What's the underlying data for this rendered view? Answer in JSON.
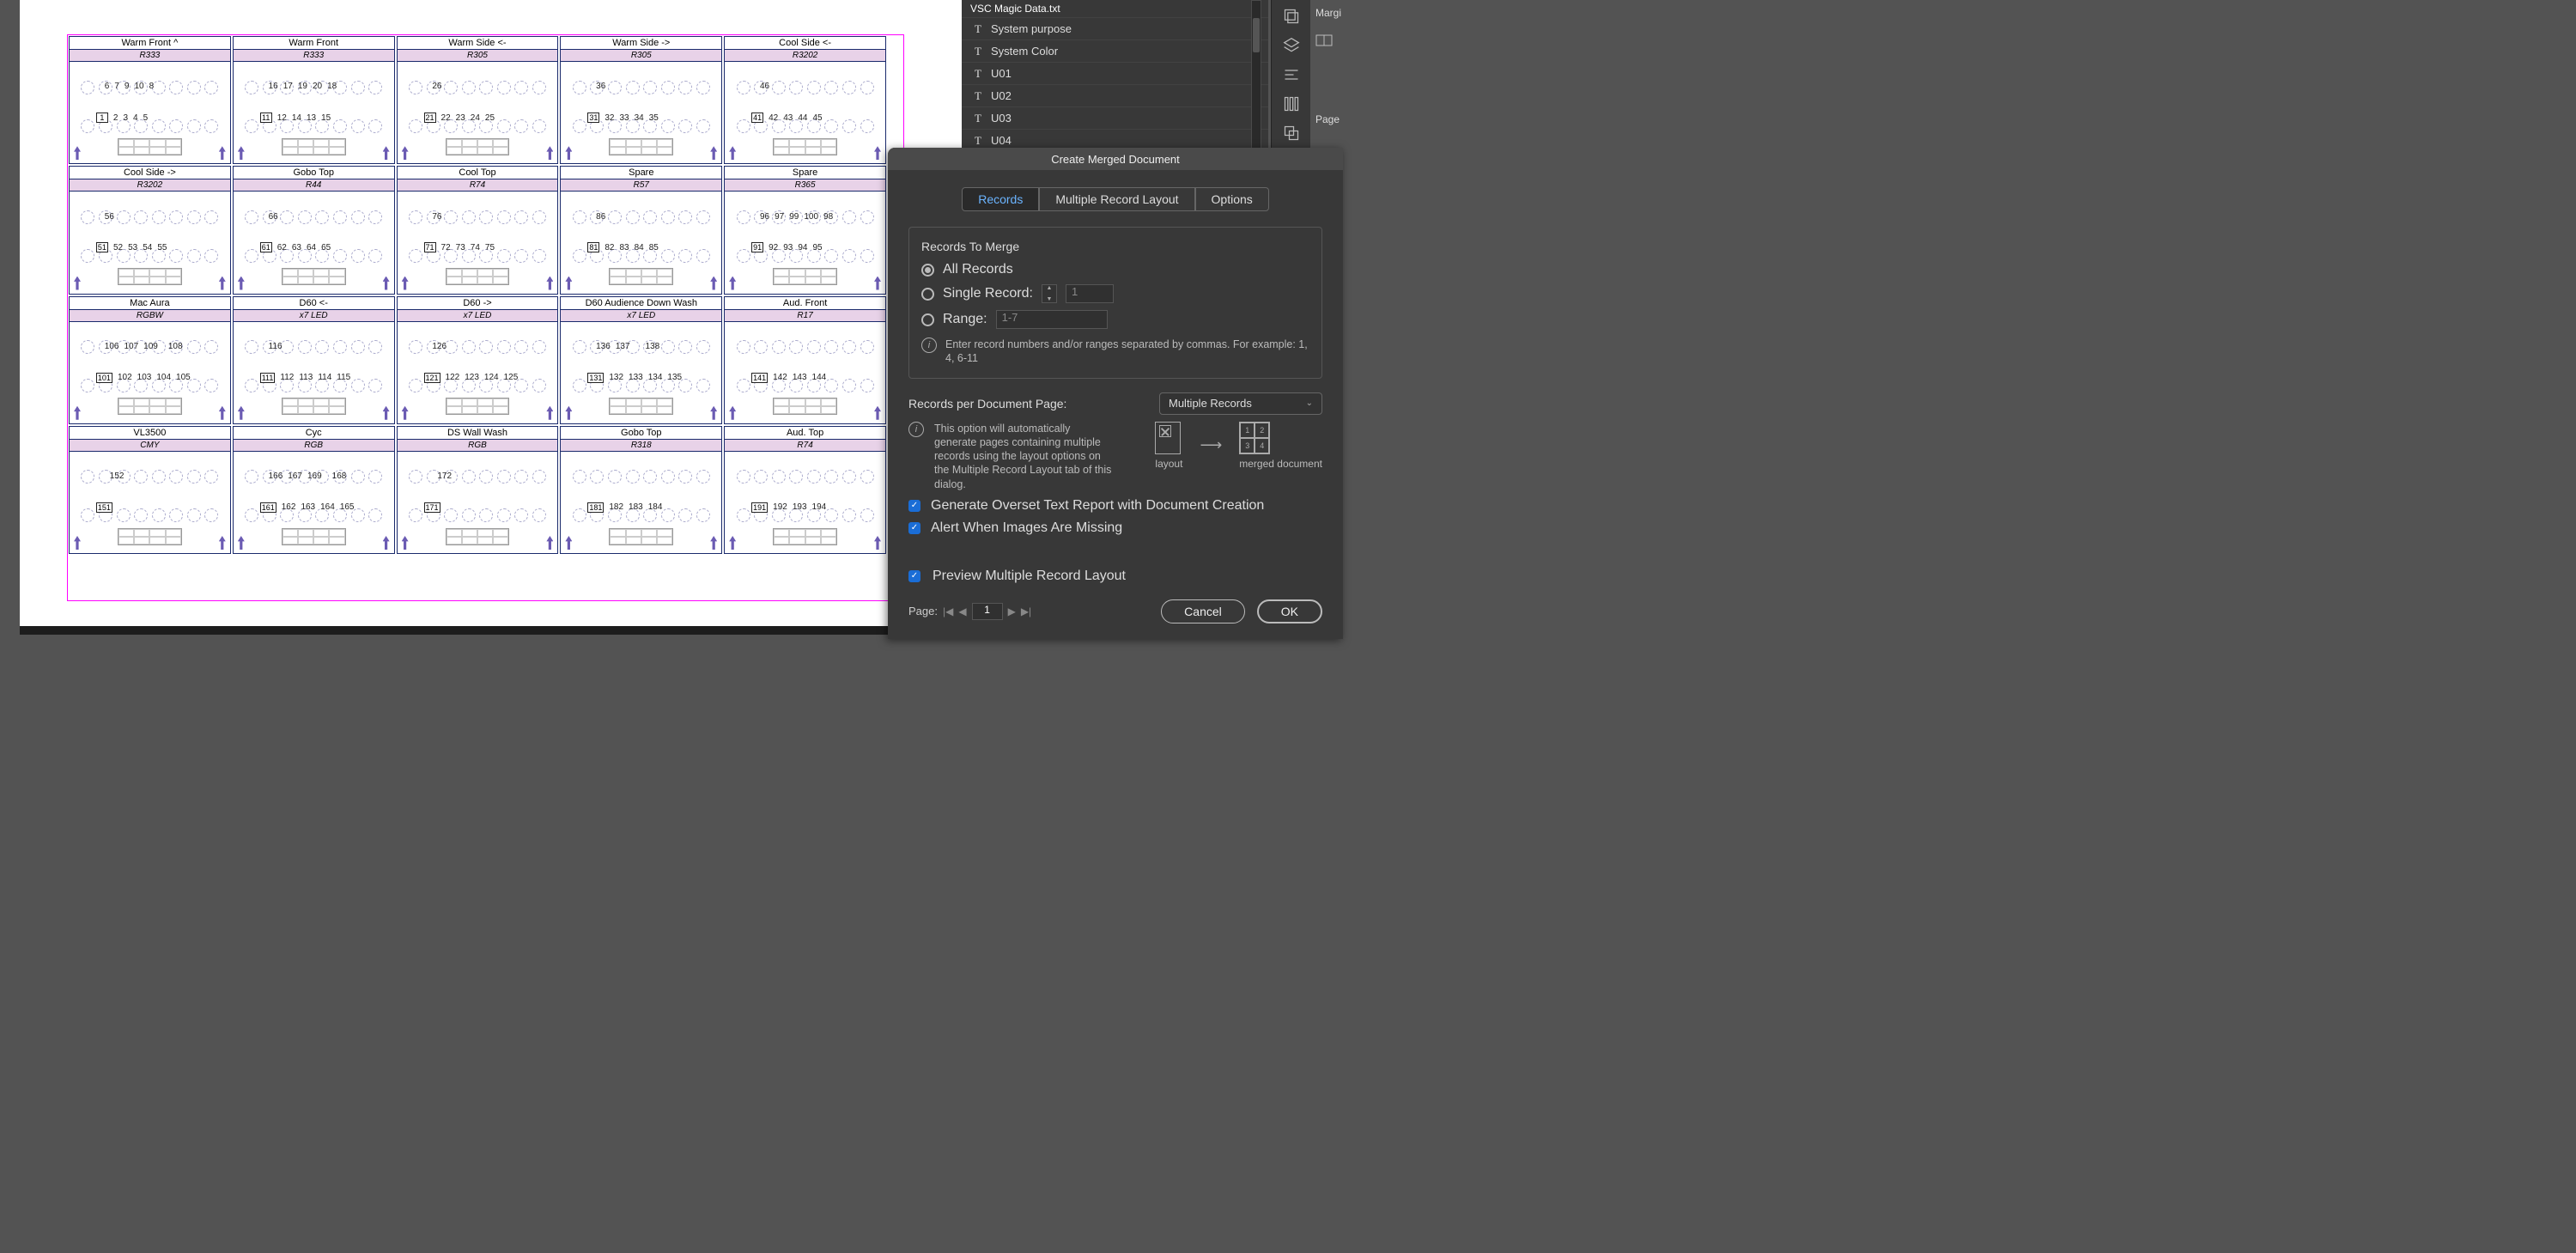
{
  "canvas": {
    "cards": [
      [
        {
          "title": "Warm Front ^",
          "sub": "R333",
          "box": "1",
          "nums": [
            "6",
            "7",
            "9",
            "10",
            "8",
            "2",
            "3",
            "4",
            "5"
          ]
        },
        {
          "title": "Warm Front",
          "sub": "R333",
          "box": "11",
          "nums": [
            "16",
            "17",
            "19",
            "20",
            "18",
            "12",
            "14",
            "13",
            "15"
          ]
        },
        {
          "title": "Warm Side <-",
          "sub": "R305",
          "box": "21",
          "nums": [
            "26",
            "",
            "",
            "",
            "",
            "22",
            "23",
            "24",
            "25"
          ]
        },
        {
          "title": "Warm Side ->",
          "sub": "R305",
          "box": "31",
          "nums": [
            "36",
            "",
            "",
            "",
            "",
            "32",
            "33",
            "34",
            "35"
          ]
        },
        {
          "title": "Cool Side <-",
          "sub": "R3202",
          "box": "41",
          "nums": [
            "46",
            "",
            "",
            "",
            "",
            "42",
            "43",
            "44",
            "45"
          ]
        }
      ],
      [
        {
          "title": "Cool Side ->",
          "sub": "R3202",
          "box": "51",
          "nums": [
            "56",
            "",
            "",
            "",
            "",
            "52",
            "53",
            "54",
            "55"
          ]
        },
        {
          "title": "Gobo Top",
          "sub": "R44",
          "box": "61",
          "nums": [
            "66",
            "",
            "",
            "",
            "",
            "62",
            "63",
            "64",
            "65"
          ]
        },
        {
          "title": "Cool Top",
          "sub": "R74",
          "box": "71",
          "nums": [
            "76",
            "",
            "",
            "",
            "",
            "72",
            "73",
            "74",
            "75"
          ]
        },
        {
          "title": "Spare",
          "sub": "R57",
          "box": "81",
          "nums": [
            "86",
            "",
            "",
            "",
            "",
            "82",
            "83",
            "84",
            "85"
          ]
        },
        {
          "title": "Spare",
          "sub": "R365",
          "box": "91",
          "nums": [
            "96",
            "97",
            "99",
            "100",
            "98",
            "92",
            "93",
            "94",
            "95"
          ]
        }
      ],
      [
        {
          "title": "Mac Aura",
          "sub": "RGBW",
          "box": "101",
          "nums": [
            "106",
            "107",
            "109",
            "",
            "108",
            "102",
            "103",
            "104",
            "105"
          ]
        },
        {
          "title": "D60 <-",
          "sub": "x7 LED",
          "box": "111",
          "nums": [
            "116",
            "",
            "",
            "",
            "",
            "112",
            "113",
            "114",
            "115"
          ]
        },
        {
          "title": "D60 ->",
          "sub": "x7 LED",
          "box": "121",
          "nums": [
            "126",
            "",
            "",
            "",
            "",
            "122",
            "123",
            "124",
            "125"
          ]
        },
        {
          "title": "D60 Audience Down Wash",
          "sub": "x7 LED",
          "box": "131",
          "nums": [
            "136",
            "137",
            "",
            "",
            "138",
            "132",
            "133",
            "134",
            "135"
          ]
        },
        {
          "title": "Aud. Front",
          "sub": "R17",
          "box": "141",
          "nums": [
            "",
            "",
            "",
            "",
            "",
            "142",
            "143",
            "144",
            ""
          ]
        }
      ],
      [
        {
          "title": "VL3500",
          "sub": "CMY",
          "box": "151",
          "nums": [
            "",
            "152",
            "",
            "",
            "",
            "",
            "",
            "",
            ""
          ]
        },
        {
          "title": "Cyc",
          "sub": "RGB",
          "box": "161",
          "nums": [
            "166",
            "167",
            "169",
            "",
            "168",
            "162",
            "163",
            "164",
            "165"
          ]
        },
        {
          "title": "DS Wall Wash",
          "sub": "RGB",
          "box": "171",
          "nums": [
            "",
            "172",
            "",
            "",
            "",
            "",
            "",
            "",
            ""
          ]
        },
        {
          "title": "Gobo Top",
          "sub": "R318",
          "box": "181",
          "nums": [
            "",
            "",
            "",
            "",
            "",
            "182",
            "183",
            "184",
            ""
          ]
        },
        {
          "title": "Aud. Top",
          "sub": "R74",
          "box": "191",
          "nums": [
            "",
            "",
            "",
            "",
            "",
            "192",
            "193",
            "194",
            ""
          ]
        }
      ]
    ]
  },
  "data_merge_panel": {
    "source_file": "VSC Magic Data.txt",
    "fields": [
      {
        "name": "System purpose",
        "count": "1"
      },
      {
        "name": "System Color",
        "count": "1"
      },
      {
        "name": "U01",
        "count": "1"
      },
      {
        "name": "U02",
        "count": "1"
      },
      {
        "name": "U03",
        "count": "1"
      },
      {
        "name": "U04",
        "count": "1"
      }
    ]
  },
  "right_labels": {
    "margins": "Margi",
    "pages": "Page"
  },
  "dialog": {
    "title": "Create Merged Document",
    "tabs": {
      "records": "Records",
      "layout": "Multiple Record Layout",
      "options": "Options"
    },
    "records_group": {
      "heading": "Records To Merge",
      "all": "All Records",
      "single_label": "Single Record:",
      "single_value": "1",
      "range_label": "Range:",
      "range_placeholder": "1-7",
      "info": "Enter record numbers and/or ranges separated by commas. For example: 1, 4, 6-11"
    },
    "rpp": {
      "label": "Records per Document Page:",
      "value": "Multiple Records",
      "info": "This option will automatically generate pages containing multiple records using the layout options on the Multiple Record Layout tab of this dialog.",
      "layout_caption": "layout",
      "merged_caption": "merged document"
    },
    "checks": {
      "overset": "Generate Overset Text Report with Document Creation",
      "missing": "Alert When Images Are Missing",
      "preview": "Preview Multiple Record Layout"
    },
    "footer": {
      "page_label": "Page:",
      "page_value": "1",
      "cancel": "Cancel",
      "ok": "OK"
    },
    "merged_cells": [
      "1",
      "2",
      "3",
      "4"
    ]
  }
}
